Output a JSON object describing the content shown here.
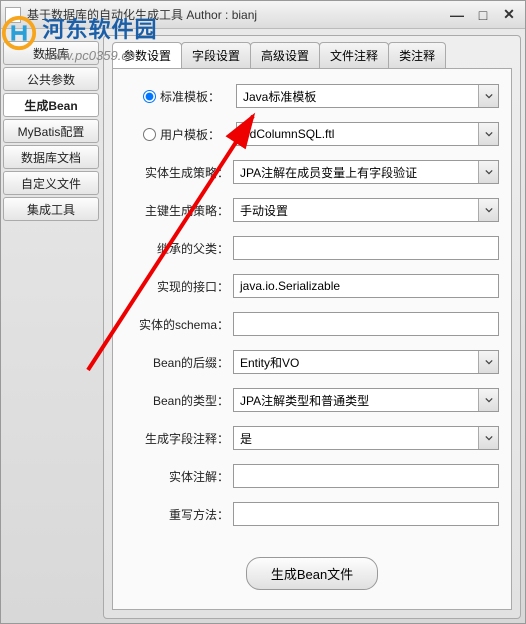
{
  "window": {
    "title": "基于数据库的自动化生成工具  Author : bianj"
  },
  "sidebar": {
    "items": [
      {
        "label": "数据库"
      },
      {
        "label": "公共参数"
      },
      {
        "label": "生成Bean"
      },
      {
        "label": "MyBatis配置"
      },
      {
        "label": "数据库文档"
      },
      {
        "label": "自定义文件"
      },
      {
        "label": "集成工具"
      }
    ],
    "activeIndex": 2
  },
  "tabs": {
    "items": [
      {
        "label": "参数设置"
      },
      {
        "label": "字段设置"
      },
      {
        "label": "高级设置"
      },
      {
        "label": "文件注释"
      },
      {
        "label": "类注释"
      }
    ],
    "activeIndex": 0
  },
  "form": {
    "template": {
      "standardLabel": "标准模板：",
      "standardValue": "Java标准模板",
      "userLabel": "用户模板：",
      "userValue": "odColumnSQL.ftl",
      "selected": "standard"
    },
    "rows": [
      {
        "label": "实体生成策略：",
        "value": "JPA注解在成员变量上有字段验证",
        "type": "combo"
      },
      {
        "label": "主键生成策略：",
        "value": "手动设置",
        "type": "combo"
      },
      {
        "label": "继承的父类：",
        "value": "",
        "type": "text"
      },
      {
        "label": "实现的接口：",
        "value": "java.io.Serializable",
        "type": "text"
      },
      {
        "label": "实体的schema：",
        "value": "",
        "type": "text"
      },
      {
        "label": "Bean的后缀：",
        "value": "Entity和VO",
        "type": "combo"
      },
      {
        "label": "Bean的类型：",
        "value": "JPA注解类型和普通类型",
        "type": "combo"
      },
      {
        "label": "生成字段注释：",
        "value": "是",
        "type": "combo"
      },
      {
        "label": "实体注解：",
        "value": "",
        "type": "text"
      },
      {
        "label": "重写方法：",
        "value": "",
        "type": "text"
      }
    ],
    "generateLabel": "生成Bean文件"
  },
  "watermark": {
    "text": "河东软件园",
    "sub": "www.pc0359.cn"
  }
}
